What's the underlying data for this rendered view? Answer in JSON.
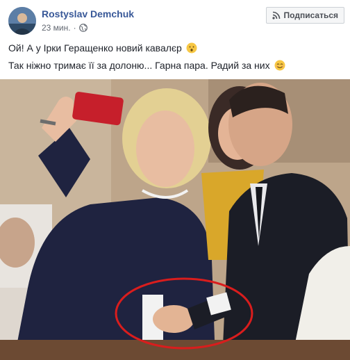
{
  "post": {
    "author": "Rostyslav Demchuk",
    "time": "23 мин.",
    "separator": "·",
    "subscribe_label": "Подписаться",
    "lines": [
      "Ой! А у Ірки Геращенко новий кавалєр",
      "Так ніжно тримає її за долоню... Гарна пара. Радий за них"
    ],
    "icons": {
      "privacy": "globe-icon",
      "subscribe": "rss-icon",
      "emoji_1": "hushed-face-emoji",
      "emoji_2": "smiling-face-emoji"
    }
  },
  "colors": {
    "author_link": "#385898",
    "annotation_circle": "#d91d1d"
  }
}
